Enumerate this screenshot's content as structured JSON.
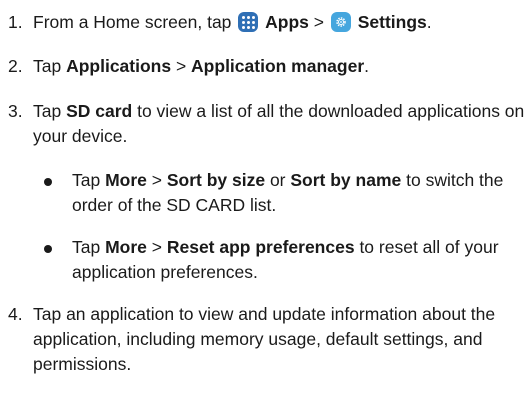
{
  "steps": [
    {
      "num": "1.",
      "t0": "From a Home screen, tap ",
      "b0": "Apps",
      "sep0": " > ",
      "b1": "Settings",
      "t1": "."
    },
    {
      "num": "2.",
      "t0": "Tap ",
      "b0": "Applications",
      "sep0": " > ",
      "b1": "Application manager",
      "t1": "."
    },
    {
      "num": "3.",
      "t0": "Tap ",
      "b0": "SD card",
      "t1": " to view a list of all the downloaded applications on your device."
    },
    {
      "num": "4.",
      "t0": "Tap an application to view and update information about the application, including memory usage, default settings, and permissions."
    }
  ],
  "bullets": [
    {
      "t0": "Tap ",
      "b0": "More",
      "sep0": " > ",
      "b1": "Sort by size",
      "t1": " or ",
      "b2": "Sort by name",
      "t2": " to switch the order of the SD CARD list."
    },
    {
      "t0": "Tap ",
      "b0": "More",
      "sep0": " > ",
      "b1": "Reset app preferences",
      "t1": " to reset all of your application preferences."
    }
  ],
  "icons": {
    "apps": "apps-grid-icon",
    "settings": "settings-gear-icon",
    "apps_color": "#2f6fb5",
    "settings_color": "#45a6de"
  }
}
